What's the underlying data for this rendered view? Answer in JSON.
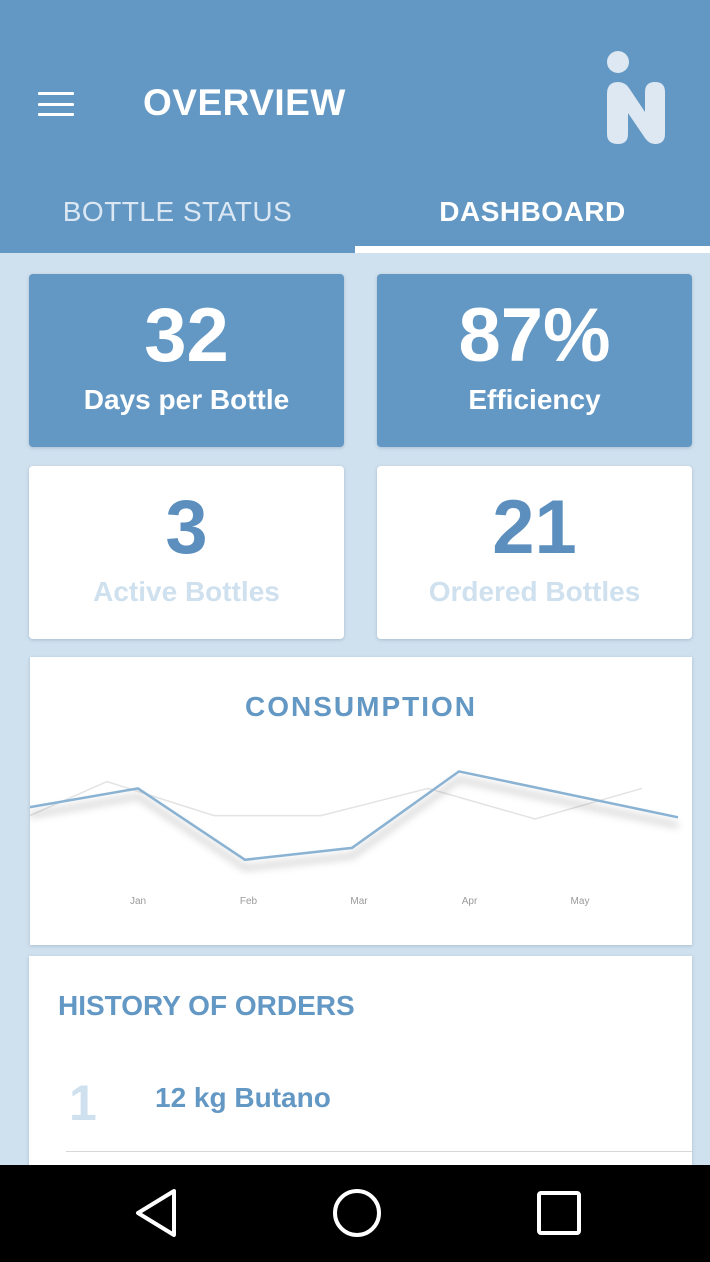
{
  "header": {
    "title": "OVERVIEW",
    "menu_icon": "hamburger-menu-icon",
    "logo_icon": "app-logo-icon"
  },
  "tabs": [
    {
      "label": "BOTTLE STATUS",
      "active": false
    },
    {
      "label": "DASHBOARD",
      "active": true
    }
  ],
  "stats": [
    {
      "value": "32",
      "label": "Days per Bottle",
      "style": "blue"
    },
    {
      "value": "87%",
      "label": "Efficiency",
      "style": "blue"
    },
    {
      "value": "3",
      "label": "Active Bottles",
      "style": "white"
    },
    {
      "value": "21",
      "label": "Ordered Bottles",
      "style": "white"
    }
  ],
  "chart_data": {
    "type": "line",
    "title": "CONSUMPTION",
    "categories": [
      "Jan",
      "Feb",
      "Mar",
      "Apr",
      "May"
    ],
    "series": [
      {
        "values": [
          47,
          58,
          16,
          23,
          68,
          41
        ],
        "color": "#8ab2d3"
      },
      {
        "values": [
          42,
          62,
          42,
          42,
          58,
          40,
          58
        ],
        "color": "#e3e3e3"
      }
    ],
    "ylim": [
      0,
      100
    ],
    "grid": false
  },
  "history": {
    "title": "HISTORY OF ORDERS",
    "orders": [
      {
        "number": "1",
        "name": "12 kg Butano"
      }
    ]
  },
  "colors": {
    "primary": "#6398c4",
    "background": "#cfe0ee",
    "muted_label": "#cfe0ee"
  },
  "navbar": {
    "icons": [
      "back-icon",
      "home-icon",
      "recents-icon"
    ]
  }
}
